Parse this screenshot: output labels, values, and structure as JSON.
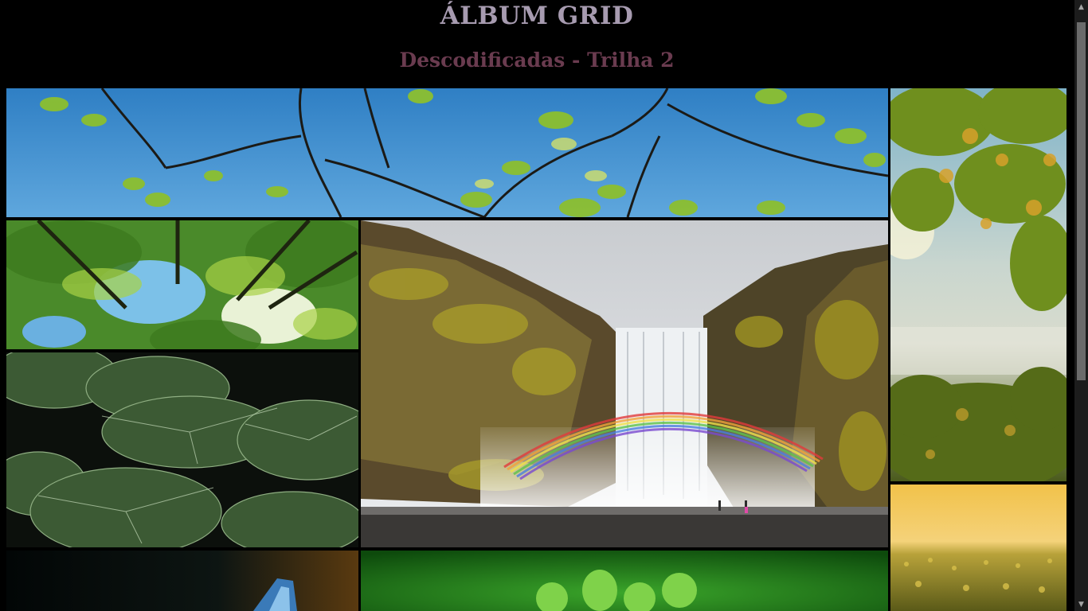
{
  "header": {
    "title": "ÁLBUM GRID",
    "subtitle": "Descodificadas - Trilha 2"
  },
  "colors": {
    "background": "#000000",
    "title": "#a79bb0",
    "subtitle": "#6a3b4f"
  },
  "gallery": {
    "photos": [
      {
        "id": "branches",
        "subject": "tree branches with green leaves against blue sky"
      },
      {
        "id": "tree",
        "subject": "autumn tree with foggy valley"
      },
      {
        "id": "canopy",
        "subject": "forest canopy seen from below"
      },
      {
        "id": "falls",
        "subject": "waterfall with rainbow and mossy cliffs"
      },
      {
        "id": "leaves",
        "subject": "large dark green leaves"
      },
      {
        "id": "meadow",
        "subject": "golden meadow at sunrise"
      },
      {
        "id": "butterfly",
        "subject": "blue butterfly on dark background"
      },
      {
        "id": "fern",
        "subject": "green fern close-up"
      }
    ]
  },
  "scrollbar": {
    "up_icon": "chevron-up-icon",
    "down_icon": "chevron-down-icon"
  }
}
